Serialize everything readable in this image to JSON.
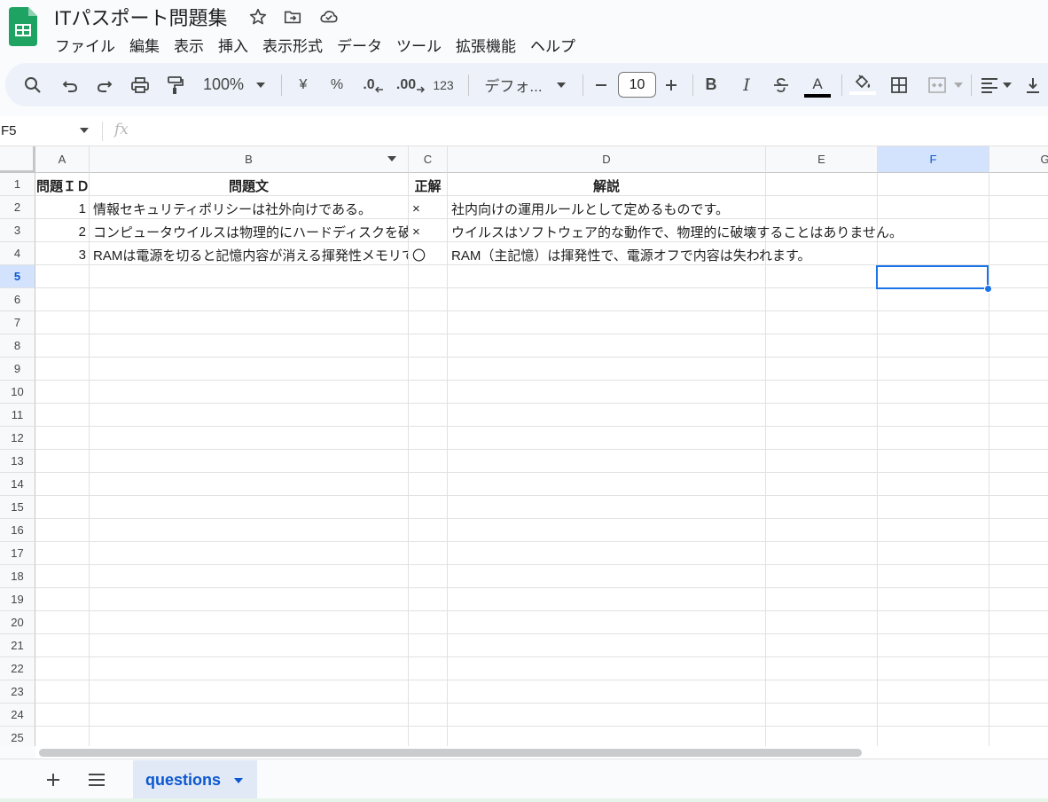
{
  "document": {
    "title": "ITパスポート問題集"
  },
  "menu": [
    "ファイル",
    "編集",
    "表示",
    "挿入",
    "表示形式",
    "データ",
    "ツール",
    "拡張機能",
    "ヘルプ"
  ],
  "toolbar": {
    "zoom": "100%",
    "currency": "¥",
    "percent": "%",
    "decrease_decimal": ".0",
    "increase_decimal": ".00",
    "format_123": "123",
    "font": "デフォ...",
    "font_size": "10",
    "bold": "B",
    "italic": "I",
    "text_color": "A"
  },
  "formula_bar": {
    "name_box": "F5",
    "fx": "fx",
    "content": ""
  },
  "columns": [
    "A",
    "B",
    "C",
    "D",
    "E",
    "F",
    "G"
  ],
  "selected_column": "F",
  "rows": [
    "1",
    "2",
    "3",
    "4",
    "5",
    "6",
    "7",
    "8",
    "9",
    "10",
    "11",
    "12",
    "13",
    "14",
    "15",
    "16",
    "17",
    "18",
    "19",
    "20",
    "21",
    "22",
    "23",
    "24",
    "25"
  ],
  "selected_row": "5",
  "cells": {
    "header": {
      "a": "問題ＩＤ",
      "b": "問題文",
      "c": "正解",
      "d": "解説"
    },
    "data": [
      {
        "id": "1",
        "question": "情報セキュリティポリシーは社外向けである。",
        "answer": "×",
        "explanation": "社内向けの運用ルールとして定めるものです。"
      },
      {
        "id": "2",
        "question": "コンピュータウイルスは物理的にハードディスクを破壊する",
        "answer": "×",
        "explanation": "ウイルスはソフトウェア的な動作で、物理的に破壊することはありません。"
      },
      {
        "id": "3",
        "question": "RAMは電源を切ると記憶内容が消える揮発性メモリである",
        "answer": "〇",
        "explanation": "RAM（主記憶）は揮発性で、電源オフで内容は失われます。"
      }
    ]
  },
  "sheets": [
    {
      "name": "questions",
      "active": true
    }
  ],
  "accent_color": "#0b57d0",
  "selection_color": "#1a73e8"
}
